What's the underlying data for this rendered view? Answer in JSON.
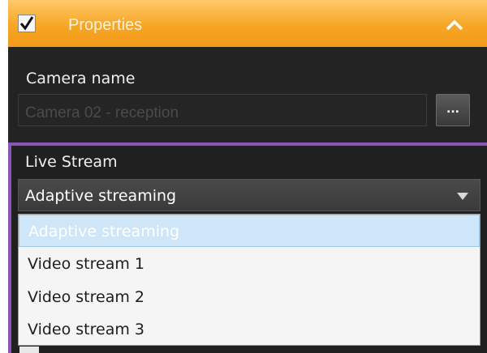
{
  "header": {
    "checked": true,
    "title": "Properties",
    "collapse_icon": "chevron-up-icon",
    "accent_color": "#f6a623"
  },
  "camera": {
    "label": "Camera name",
    "value": "Camera 02 - reception",
    "browse_label": "..."
  },
  "live_stream": {
    "label": "Live Stream",
    "selected": "Adaptive streaming",
    "border_color": "#8a56b6",
    "options": [
      {
        "label": "Adaptive streaming",
        "highlighted": true
      },
      {
        "label": "Video stream 1",
        "highlighted": false
      },
      {
        "label": "Video stream 2",
        "highlighted": false
      },
      {
        "label": "Video stream 3",
        "highlighted": false
      }
    ]
  }
}
